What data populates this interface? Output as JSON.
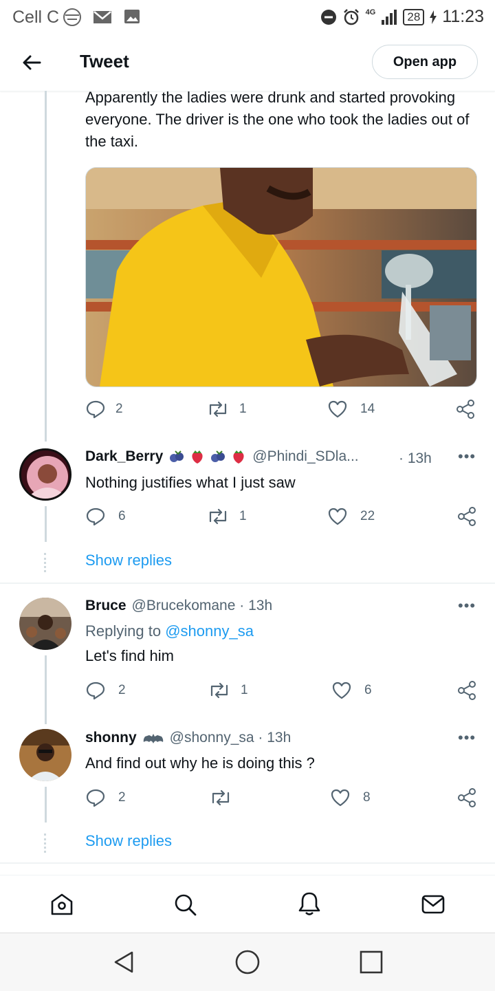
{
  "status_bar": {
    "carrier": "Cell C",
    "network": "4G",
    "battery": "28",
    "time": "11:23"
  },
  "header": {
    "title": "Tweet",
    "open_app": "Open app"
  },
  "main_tweet": {
    "text": "Apparently the ladies were drunk and started provoking everyone. The driver is the one who took the ladies out of the taxi.",
    "replies": "2",
    "retweets": "1",
    "likes": "14"
  },
  "replies": [
    {
      "name": "Dark_Berry",
      "handle": "@Phindi_SDla...",
      "time": "· 13h",
      "text": "Nothing justifies what I just saw",
      "replies": "6",
      "retweets": "1",
      "likes": "22",
      "show_replies": "Show replies"
    },
    {
      "name": "Bruce",
      "handle": "@Brucekomane · 13h",
      "replying_prefix": "Replying to ",
      "replying_to": "@shonny_sa",
      "text": "Let's find him",
      "replies": "2",
      "retweets": "1",
      "likes": "6"
    },
    {
      "name": "shonny",
      "handle": "@shonny_sa · 13h",
      "text": "And find out why he is doing this ?",
      "replies": "2",
      "retweets": "",
      "likes": "8",
      "show_replies": "Show replies"
    }
  ],
  "icons": {
    "accent": "#1d9bf0",
    "action_gray": "#536471"
  }
}
